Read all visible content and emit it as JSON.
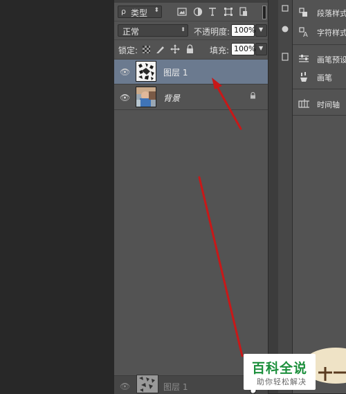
{
  "filter": {
    "type_label": "类型",
    "search_glyph": "ρ"
  },
  "blend": {
    "mode": "正常",
    "opacity_label": "不透明度:",
    "opacity_value": "100%"
  },
  "lock": {
    "label": "锁定:",
    "fill_label": "填充:",
    "fill_value": "100%"
  },
  "layers": [
    {
      "name": "图层 1",
      "selected": true,
      "visible": true,
      "locked": false
    },
    {
      "name": "背景",
      "selected": false,
      "visible": true,
      "locked": true
    }
  ],
  "drag_ghost": {
    "name": "图层 1"
  },
  "right_dock": {
    "items": [
      {
        "label": "段落样式",
        "icon": "paragraph-styles-icon"
      },
      {
        "label": "字符样式",
        "icon": "character-styles-icon"
      },
      {
        "label": "画笔预设",
        "icon": "brush-presets-icon"
      },
      {
        "label": "画笔",
        "icon": "brush-icon"
      },
      {
        "label": "时间轴",
        "icon": "timeline-icon"
      }
    ]
  },
  "watermark": {
    "title": "百科全说",
    "subtitle": "助你轻松解决"
  },
  "colors": {
    "selected_row": "#6b7a8f",
    "annotation_arrow": "#c81818",
    "watermark_green": "#1c8f3c"
  }
}
